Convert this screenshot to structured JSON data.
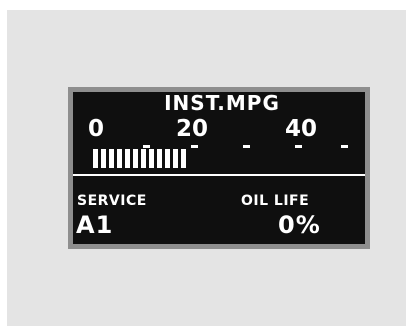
{
  "display": {
    "title": "INST.MPG",
    "scale_labels": [
      "0",
      "20",
      "40"
    ],
    "bar_fill_fraction": 0.39,
    "service_label": "SERVICE",
    "service_code": "A1",
    "oil_life_label": "OIL LIFE",
    "oil_life_value": "0%"
  },
  "colors": {
    "panel_background": "#e4e4e4",
    "bezel": "#8e8e8e",
    "screen_background": "#0f0f0f",
    "screen_text": "#ffffff"
  }
}
